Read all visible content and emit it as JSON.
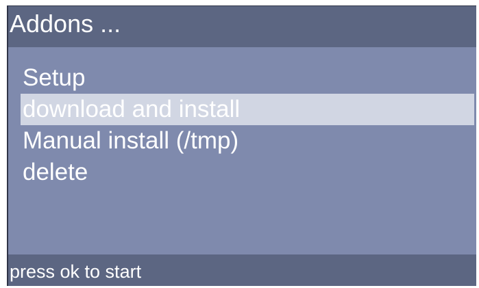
{
  "title": "Addons ...",
  "menu": {
    "selected_index": 1,
    "items": [
      {
        "label": "Setup"
      },
      {
        "label": "download and install"
      },
      {
        "label": "Manual install (/tmp)"
      },
      {
        "label": "delete"
      }
    ]
  },
  "status": "press ok to start",
  "colors": {
    "title_bar_bg": "#5c6682",
    "body_bg": "#7f8aad",
    "selection_bg": "#d1d6e3",
    "text": "#ffffff"
  }
}
